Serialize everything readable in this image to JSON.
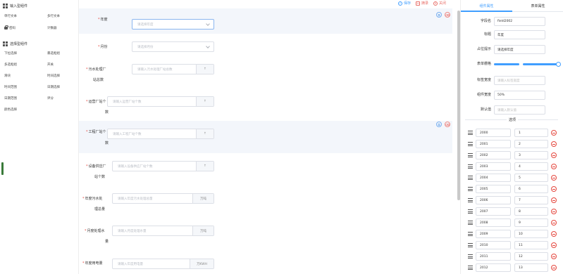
{
  "toolbar": {
    "save": "保存",
    "preview": "摘录",
    "close": "关闭"
  },
  "left": {
    "input_section": "输入型组件",
    "input_items": [
      {
        "label": "单行文本"
      },
      {
        "label": "多行文本"
      },
      {
        "label": "密码"
      },
      {
        "label": "计数器"
      }
    ],
    "select_section": "选择型组件",
    "select_items": [
      {
        "label": "下拉选择"
      },
      {
        "label": "暴选框组"
      },
      {
        "label": "多选框组"
      },
      {
        "label": "开关"
      },
      {
        "label": "滑块"
      },
      {
        "label": "时间选择"
      },
      {
        "label": "时间范围"
      },
      {
        "label": "日期选择"
      },
      {
        "label": "日期范围"
      },
      {
        "label": "评分"
      },
      {
        "label": "颜色选择"
      }
    ]
  },
  "form": {
    "rows": [
      {
        "label": "年度",
        "placeholder": "请选择年度",
        "kind": "select"
      },
      {
        "label": "月份",
        "placeholder": "请选择月份",
        "kind": "select"
      },
      {
        "label": "污水处理厂",
        "label2": "站总数",
        "placeholder": "请输入污水处理厂站总数",
        "append": "↑"
      },
      {
        "label": "运营厂站个",
        "label2": "数",
        "placeholder": "请输入运营厂站个数",
        "append": "↑"
      },
      {
        "label": "工程厂站个",
        "label2": "数",
        "placeholder": "请输入工程厂站个数",
        "append": "↑"
      },
      {
        "label": "设备供应厂",
        "label2": "站个数",
        "placeholder": "请输入设备供应厂站个数",
        "append": "↑"
      },
      {
        "label": "年度污水处",
        "label2": "理总量",
        "placeholder": "请输入年度污水处理总量",
        "append": "万吨"
      },
      {
        "label": "月度处理水",
        "label2": "量",
        "placeholder": "请输入月度处理水量",
        "append": "万吨"
      },
      {
        "label": "年度用电量",
        "label2": "",
        "placeholder": "请输入年度用电量",
        "append": "万KWH"
      }
    ]
  },
  "right": {
    "tab_component": "组件属性",
    "tab_form": "表单属性",
    "props": [
      {
        "label": "字段名",
        "value": "field2002",
        "ph": false
      },
      {
        "label": "标题",
        "value": "年度",
        "ph": false
      },
      {
        "label": "占位提示",
        "value": "请选择年度",
        "ph": false
      },
      {
        "label": "表单栅格",
        "value": "",
        "ph": false
      },
      {
        "label": "标签宽度",
        "value": "请输入标签宽度",
        "ph": true
      },
      {
        "label": "组件宽度",
        "value": "50%",
        "ph": false
      },
      {
        "label": "默认值",
        "value": "请输入默认值",
        "ph": true
      }
    ],
    "grid_span": 24,
    "options_title": "选项",
    "options": [
      {
        "label": "2000",
        "value": "1"
      },
      {
        "label": "2001",
        "value": "2"
      },
      {
        "label": "2002",
        "value": "3"
      },
      {
        "label": "2003",
        "value": "4"
      },
      {
        "label": "2004",
        "value": "5"
      },
      {
        "label": "2005",
        "value": "6"
      },
      {
        "label": "2006",
        "value": "7"
      },
      {
        "label": "2007",
        "value": "8"
      },
      {
        "label": "2008",
        "value": "9"
      },
      {
        "label": "2009",
        "value": "10"
      },
      {
        "label": "2010",
        "value": "11"
      },
      {
        "label": "2011",
        "value": "12"
      },
      {
        "label": "2012",
        "value": "13"
      }
    ]
  }
}
